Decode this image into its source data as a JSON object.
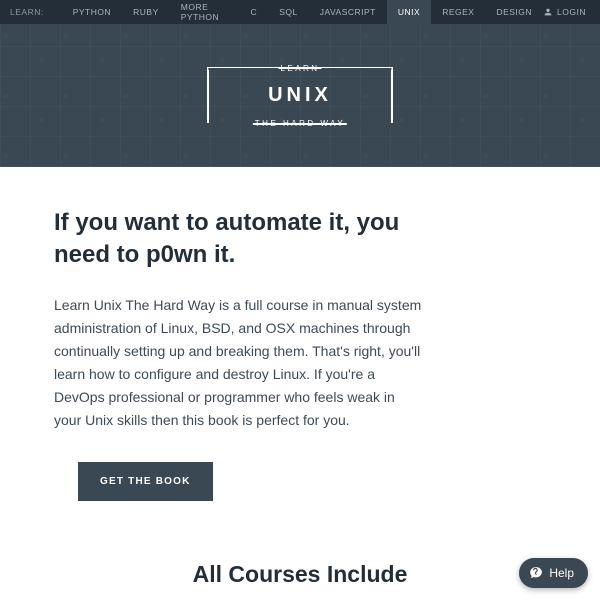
{
  "nav": {
    "label": "LEARN:",
    "items": [
      {
        "label": "PYTHON",
        "active": false
      },
      {
        "label": "RUBY",
        "active": false
      },
      {
        "label": "MORE PYTHON",
        "active": false
      },
      {
        "label": "C",
        "active": false
      },
      {
        "label": "SQL",
        "active": false
      },
      {
        "label": "JAVASCRIPT",
        "active": false
      },
      {
        "label": "UNIX",
        "active": true
      },
      {
        "label": "REGEX",
        "active": false
      },
      {
        "label": "DESIGN",
        "active": false
      }
    ],
    "login": "LOGIN"
  },
  "hero": {
    "top_label": "LEARN",
    "title": "UNIX",
    "bottom_label": "THE HARD WAY"
  },
  "main": {
    "headline": "If you want to automate it, you need to p0wn it.",
    "body": "Learn Unix The Hard Way is a full course in manual system administration of Linux, BSD, and OSX machines through continually setting up and breaking them. That's right, you'll learn how to configure and destroy Linux. If you're a DevOps professional or programmer who feels weak in your Unix skills then this book is perfect for you.",
    "cta": "GET THE BOOK"
  },
  "section2": {
    "title": "All Courses Include"
  },
  "help": {
    "label": "Help"
  }
}
